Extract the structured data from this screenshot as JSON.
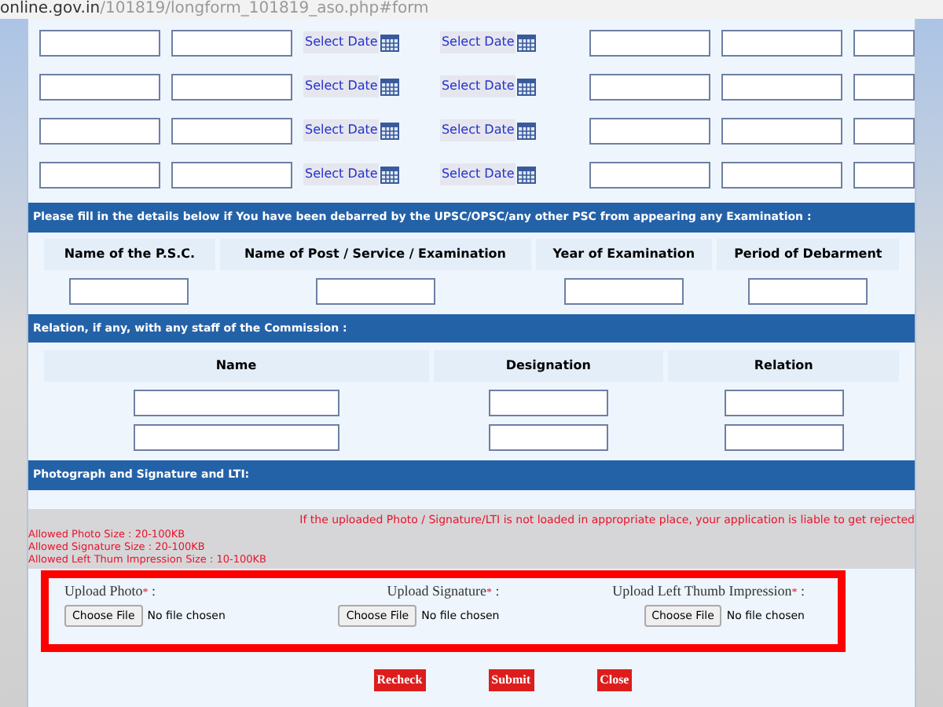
{
  "address_bar": {
    "domain": "online.gov.in",
    "path": "/101819/longform_101819_aso.php#form"
  },
  "date_rows": [
    {
      "date_buttons": [
        "Select Date",
        "Select Date"
      ]
    },
    {
      "date_buttons": [
        "Select Date",
        "Select Date"
      ]
    },
    {
      "date_buttons": [
        "Select Date",
        "Select Date"
      ]
    },
    {
      "date_buttons": [
        "Select Date",
        "Select Date"
      ]
    }
  ],
  "debarment": {
    "title": "Please fill in the details below if You have been debarred by the UPSC/OPSC/any other PSC from appearing any Examination :",
    "columns": [
      "Name of the P.S.C.",
      "Name of Post / Service / Examination",
      "Year of Examination",
      "Period of Debarment"
    ]
  },
  "relation": {
    "title": "Relation, if any, with any staff of the Commission :",
    "columns": [
      "Name",
      "Designation",
      "Relation"
    ]
  },
  "uploads_section": {
    "title": "Photograph and Signature and LTI:",
    "warning": "If the uploaded Photo / Signature/LTI is not loaded in appropriate place, your application is liable to get rejected",
    "size_notes": [
      "Allowed Photo Size : 20-100KB",
      "Allowed Signature Size : 20-100KB",
      "Allowed Left Thum Impression Size : 10-100KB"
    ],
    "uploads": [
      {
        "label": "Upload Photo",
        "required_mark": "*",
        "suffix": ":",
        "button": "Choose File",
        "status": "No file chosen"
      },
      {
        "label": "Upload Signature",
        "required_mark": "*",
        "suffix": ":",
        "button": "Choose File",
        "status": "No file chosen"
      },
      {
        "label": "Upload Left Thumb Impression",
        "required_mark": "*",
        "suffix": ":",
        "button": "Choose File",
        "status": "No file chosen"
      }
    ]
  },
  "actions": [
    "Recheck",
    "Submit",
    "Close"
  ]
}
